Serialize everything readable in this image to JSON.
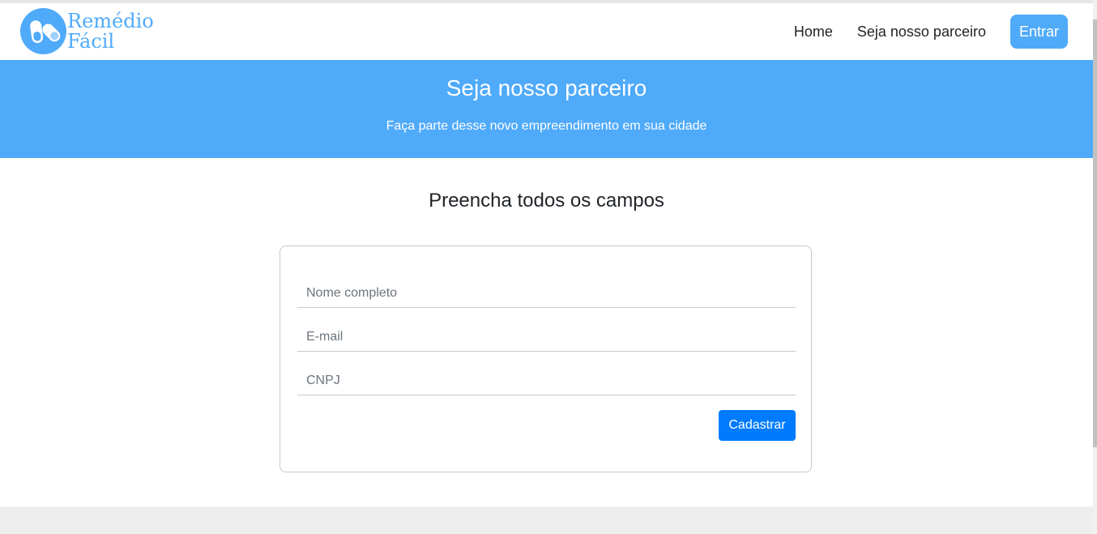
{
  "colors": {
    "brand": "#4faafa",
    "primary": "#007bff",
    "footer": "#eeeeee"
  },
  "brand": {
    "line1": "Remédio",
    "line2": "Fácil",
    "icon": "pill-capsule-icon"
  },
  "nav": {
    "home": "Home",
    "partner": "Seja nosso parceiro",
    "login": "Entrar"
  },
  "hero": {
    "title": "Seja nosso parceiro",
    "subtitle": "Faça parte desse novo empreendimento em sua cidade"
  },
  "form": {
    "heading": "Preencha todos os campos",
    "name_placeholder": "Nome completo",
    "email_placeholder": "E-mail",
    "cnpj_placeholder": "CNPJ",
    "submit": "Cadastrar"
  }
}
